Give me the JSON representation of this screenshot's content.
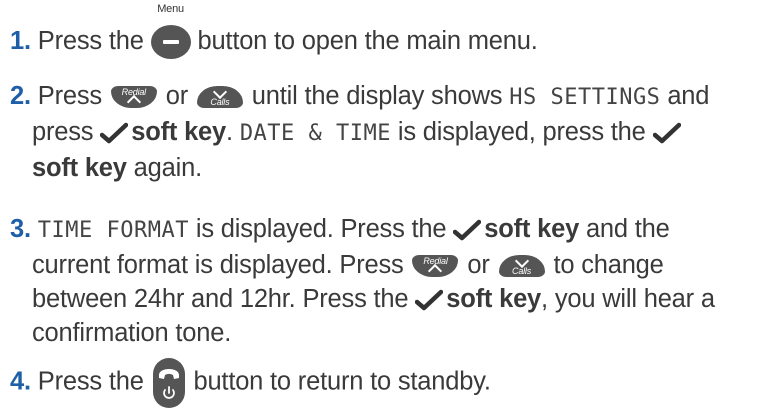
{
  "steps": [
    {
      "number": "1.",
      "before": "Press the",
      "button_label": "Menu",
      "after": "button to open the main menu."
    },
    {
      "number": "2.",
      "press": "Press",
      "redial_label": "Redial",
      "or": "or",
      "calls_label": "Calls",
      "until": "until the display shows",
      "display1": "HS SETTINGS",
      "and": "and",
      "press2": "press",
      "soft_key": "soft key",
      "period": ".",
      "display2": "DATE & TIME",
      "is_displayed": "is displayed, press the",
      "soft_key2": "soft key",
      "again": "again."
    },
    {
      "number": "3.",
      "display": "TIME FORMAT",
      "is_displayed": "is displayed. Press the",
      "soft_key": "soft key",
      "and_the": "and the",
      "current": "current format is displayed. Press",
      "redial_label": "Redial",
      "or": "or",
      "calls_label": "Calls",
      "to_change": "to change",
      "between": "between 24hr and 12hr. Press the",
      "soft_key2": "soft key",
      "you_will": ", you will hear a",
      "confirm": "confirmation tone."
    },
    {
      "number": "4.",
      "before": "Press the",
      "after": "button to return to standby."
    }
  ],
  "colors": {
    "step_number": "#1f5fa8",
    "text": "#3a3a3a",
    "button": "#555555"
  },
  "icons": [
    "menu-button-icon",
    "redial-up-button-icon",
    "calls-down-button-icon",
    "tick-icon",
    "end-call-button-icon"
  ]
}
